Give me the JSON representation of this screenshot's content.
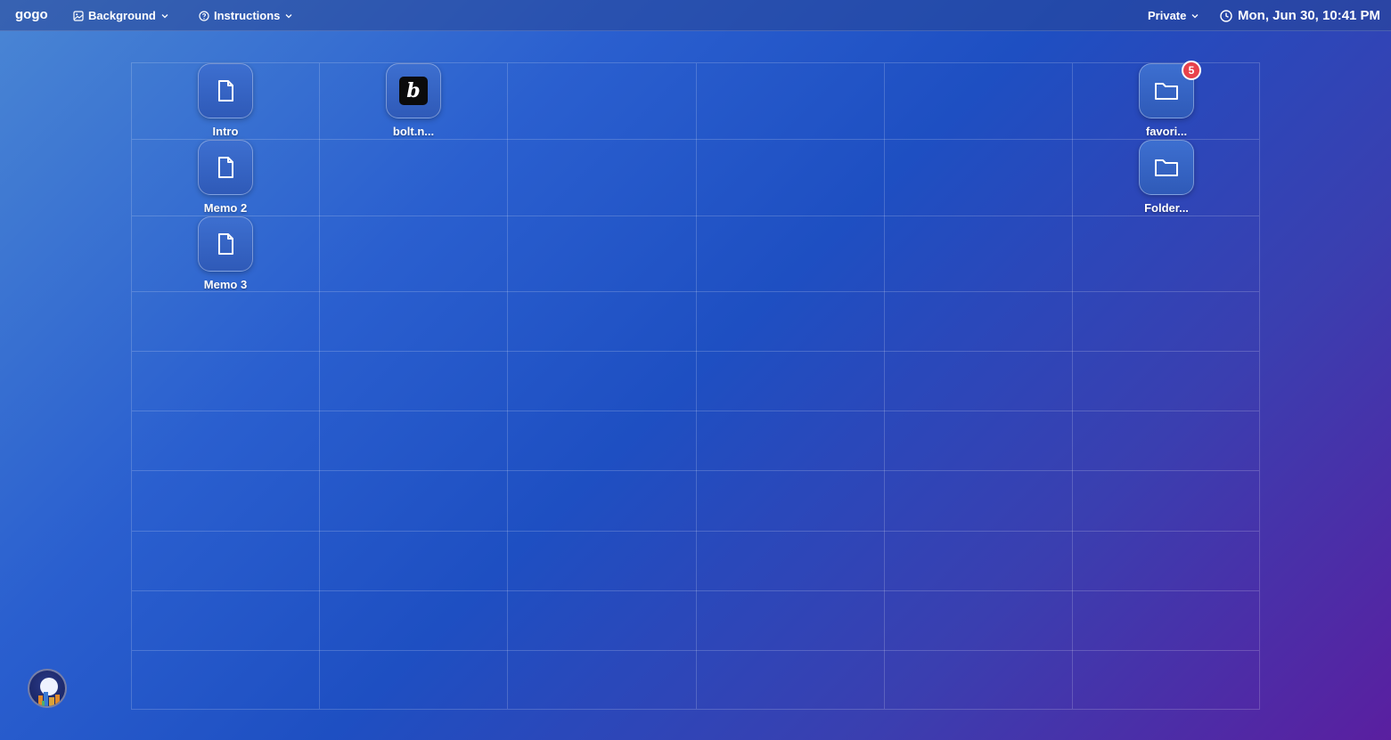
{
  "topbar": {
    "logo": "gogo",
    "background_menu": "Background",
    "instructions_menu": "Instructions",
    "privacy_menu": "Private",
    "datetime": "Mon, Jun 30, 10:41 PM"
  },
  "desktop": {
    "items": [
      {
        "label": "Intro",
        "icon": "document-icon"
      },
      {
        "label": "bolt.n...",
        "icon": "bolt-app-icon"
      },
      {
        "label": "favori...",
        "icon": "folder-icon",
        "badge": "5"
      },
      {
        "label": "Memo 2",
        "icon": "document-icon"
      },
      {
        "label": "Folder...",
        "icon": "folder-icon"
      },
      {
        "label": "Memo 3",
        "icon": "document-icon"
      }
    ]
  },
  "colors": {
    "badge": "#e8424b",
    "bg_start": "#4a86d4",
    "bg_end": "#5a1fa0"
  }
}
